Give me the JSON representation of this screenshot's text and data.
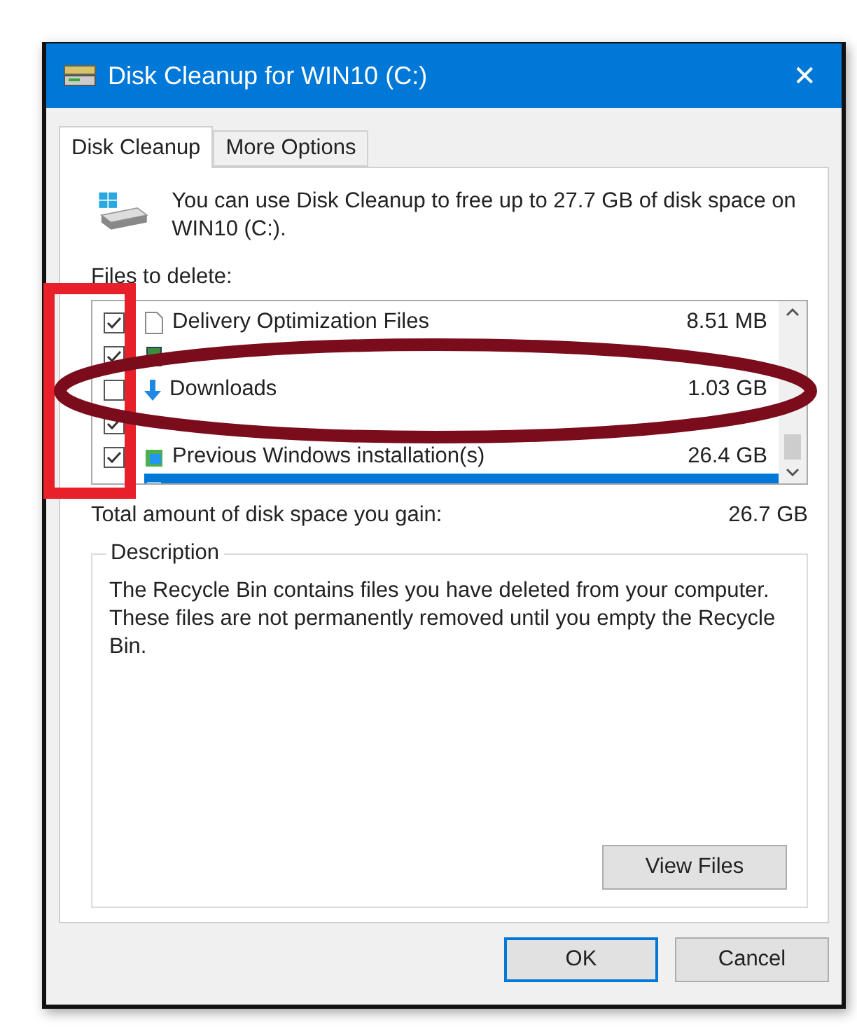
{
  "window": {
    "title": "Disk Cleanup for WIN10 (C:)",
    "close": "✕"
  },
  "tabs": [
    {
      "label": "Disk Cleanup",
      "selected": true
    },
    {
      "label": "More Options",
      "selected": false
    }
  ],
  "intro": "You can use Disk Cleanup to free up to 27.7 GB of disk space on WIN10 (C:).",
  "files_label": "Files to delete:",
  "files": [
    {
      "name": "Delivery Optimization Files",
      "size": "8.51 MB",
      "checked": true,
      "selected": false
    },
    {
      "checked": true,
      "selected": false
    },
    {
      "name": "Downloads",
      "size": "1.03 GB",
      "checked": false,
      "selected": false
    },
    {
      "checked": true,
      "selected": false
    },
    {
      "name": "Previous Windows installation(s)",
      "size": "26.4 GB",
      "checked": true,
      "selected": false
    },
    {
      "selected": true
    }
  ],
  "total": {
    "label": "Total amount of disk space you gain:",
    "value": "26.7 GB"
  },
  "description": {
    "title": "Description",
    "text": "The Recycle Bin contains files you have deleted from your computer. These files are not permanently removed until you empty the Recycle Bin.",
    "button": "View Files"
  },
  "buttons": [
    {
      "label": "OK",
      "default": true
    },
    {
      "label": "Cancel",
      "default": false
    }
  ],
  "annotations": [
    {
      "kind": "rectangle",
      "color": "#e8202a"
    },
    {
      "kind": "ellipse",
      "color": "#7a0c1c"
    }
  ]
}
